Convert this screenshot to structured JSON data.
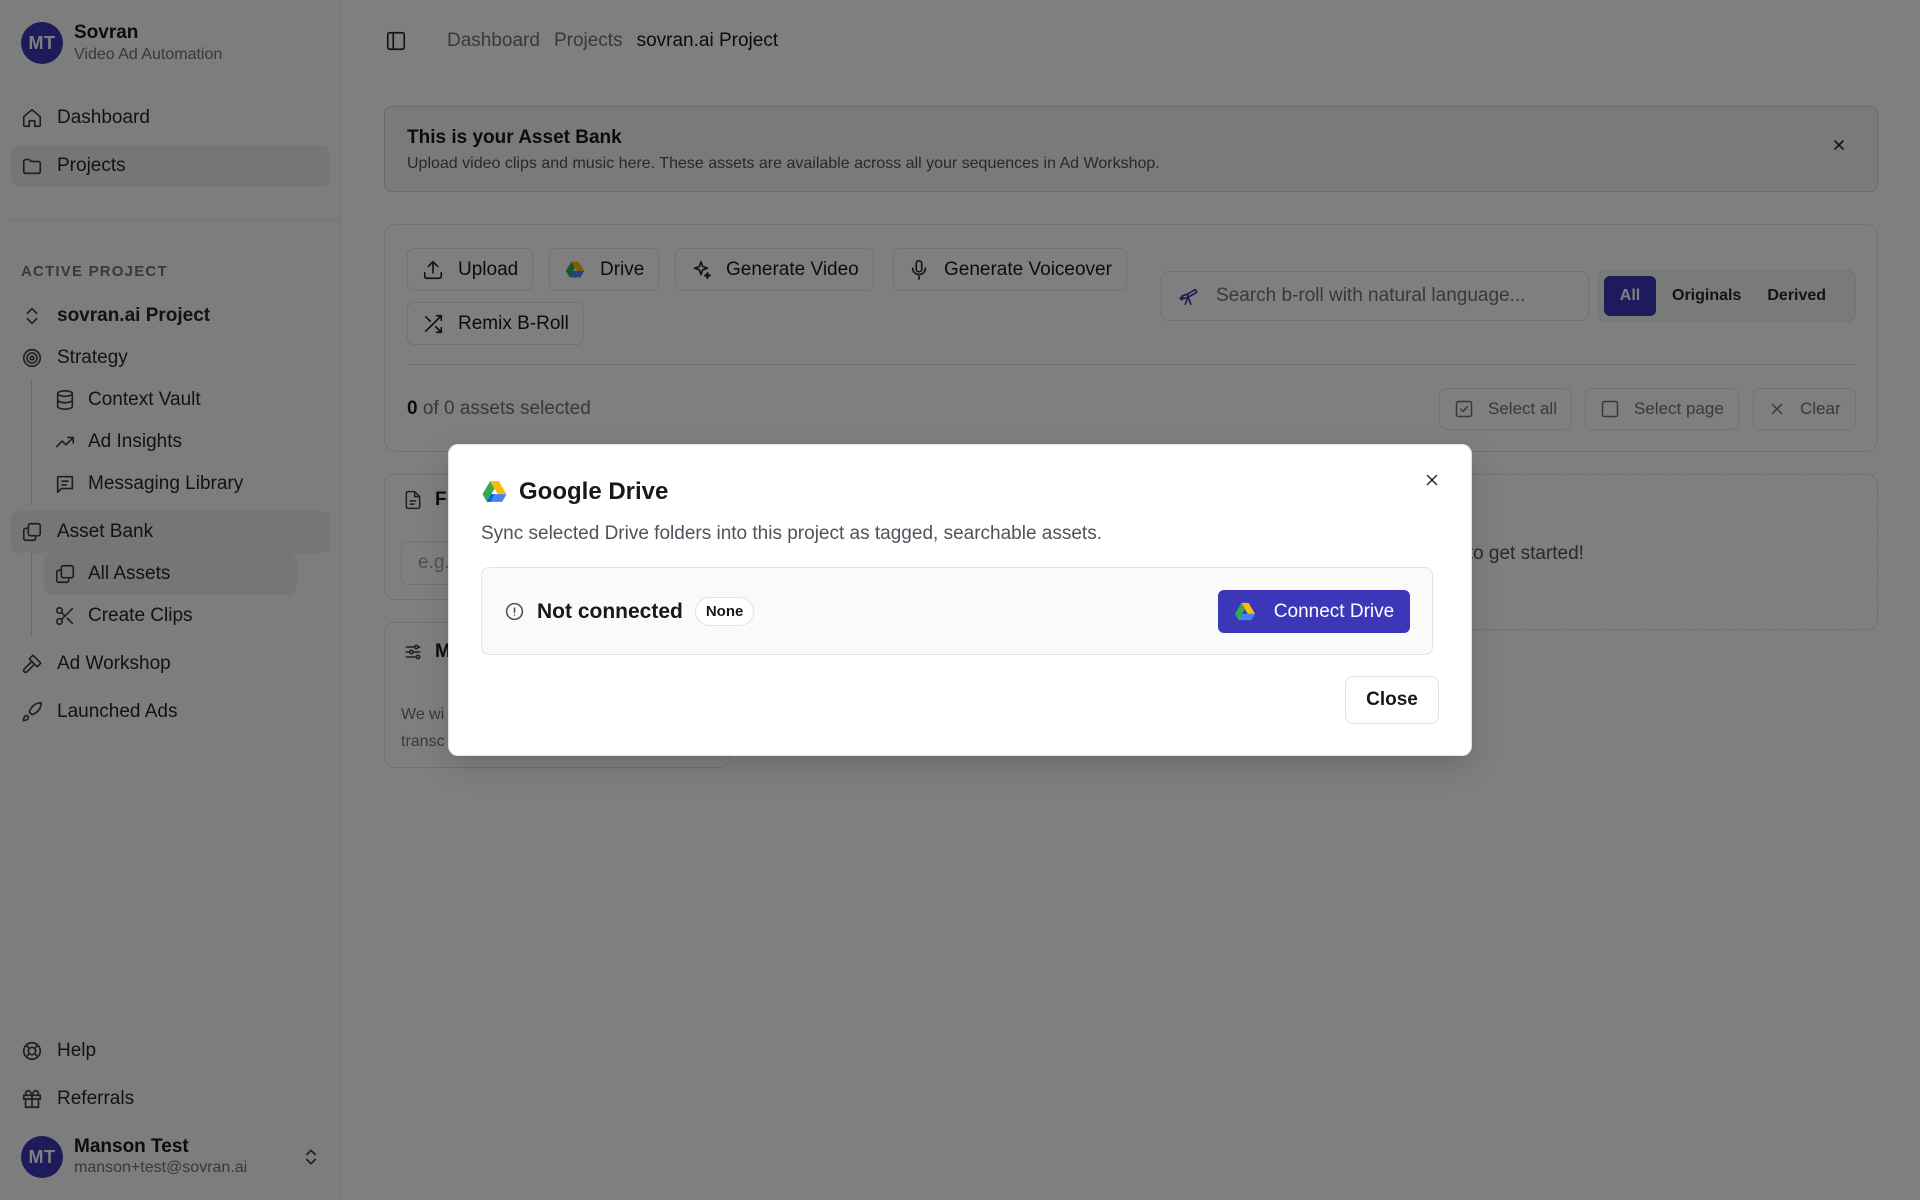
{
  "brand": {
    "initials": "MT",
    "name": "Sovran",
    "subtitle": "Video Ad Automation"
  },
  "nav_top": [
    {
      "label": "Dashboard",
      "icon": "home-icon"
    },
    {
      "label": "Projects",
      "icon": "folder-icon",
      "active": true
    }
  ],
  "section_label": "ACTIVE PROJECT",
  "project": {
    "name": "sovran.ai Project",
    "strategy": "Strategy",
    "strategy_items": [
      "Context Vault",
      "Ad Insights",
      "Messaging Library"
    ],
    "asset_bank": "Asset Bank",
    "asset_items": [
      "All Assets",
      "Create Clips"
    ],
    "ad_workshop": "Ad Workshop",
    "launched_ads": "Launched Ads"
  },
  "nav_bottom": {
    "help": "Help",
    "referrals": "Referrals"
  },
  "user": {
    "initials": "MT",
    "name": "Manson Test",
    "email": "manson+test@sovran.ai"
  },
  "breadcrumb": [
    "Dashboard",
    "Projects",
    "sovran.ai Project"
  ],
  "banner": {
    "title": "This is your Asset Bank",
    "text": "Upload video clips and music here. These assets are available across all your sequences in Ad Workshop."
  },
  "toolbar": {
    "upload": "Upload",
    "drive": "Drive",
    "generate_video": "Generate Video",
    "generate_voiceover": "Generate Voiceover",
    "remix": "Remix B-Roll",
    "search_placeholder": "Search b-roll with natural language...",
    "filters": [
      "All",
      "Originals",
      "Derived"
    ],
    "selected_count": "0",
    "selected_suffix": " of 0 assets selected",
    "select_all": "Select all",
    "select_page": "Select page",
    "clear": "Clear"
  },
  "background_partial": {
    "filters_head": "Fi",
    "filters_input": "e.g.",
    "media_head": "M",
    "media_text_1": "We wi",
    "media_text_2": "transc",
    "empty_text": "c to get started!"
  },
  "modal": {
    "title": "Google Drive",
    "subtitle": "Sync selected Drive folders into this project as tagged, searchable assets.",
    "status": "Not connected",
    "badge": "None",
    "connect": "Connect Drive",
    "close": "Close"
  },
  "colors": {
    "accent": "#3b37b8",
    "overlay": "rgba(0,0,0,0.50)"
  }
}
